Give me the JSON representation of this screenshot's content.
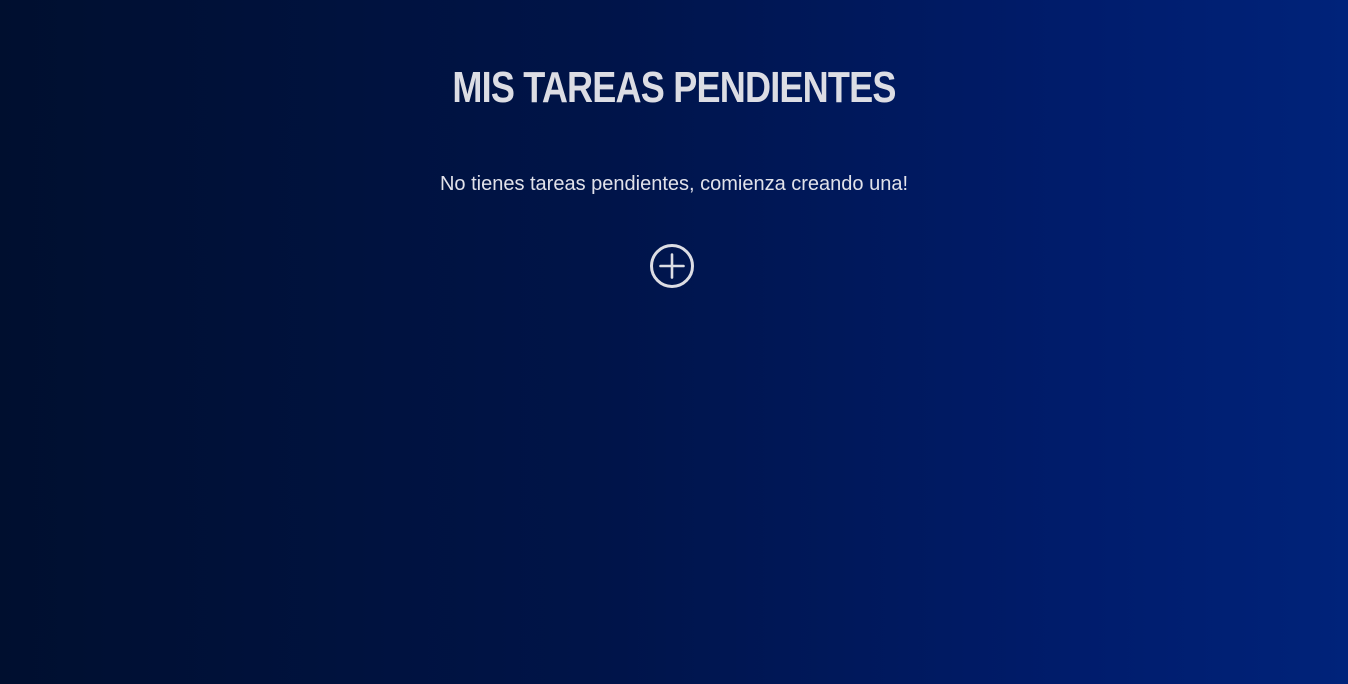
{
  "page": {
    "title": "Mis tareas pendientes",
    "empty_message": "No tienes tareas pendientes, comienza creando una!"
  },
  "add_button": {
    "icon": "plus-circle-icon",
    "color": "#dcdde4"
  },
  "colors": {
    "background_start": "#000f2f",
    "background_end": "#00237a",
    "text": "#e1e2ea"
  }
}
